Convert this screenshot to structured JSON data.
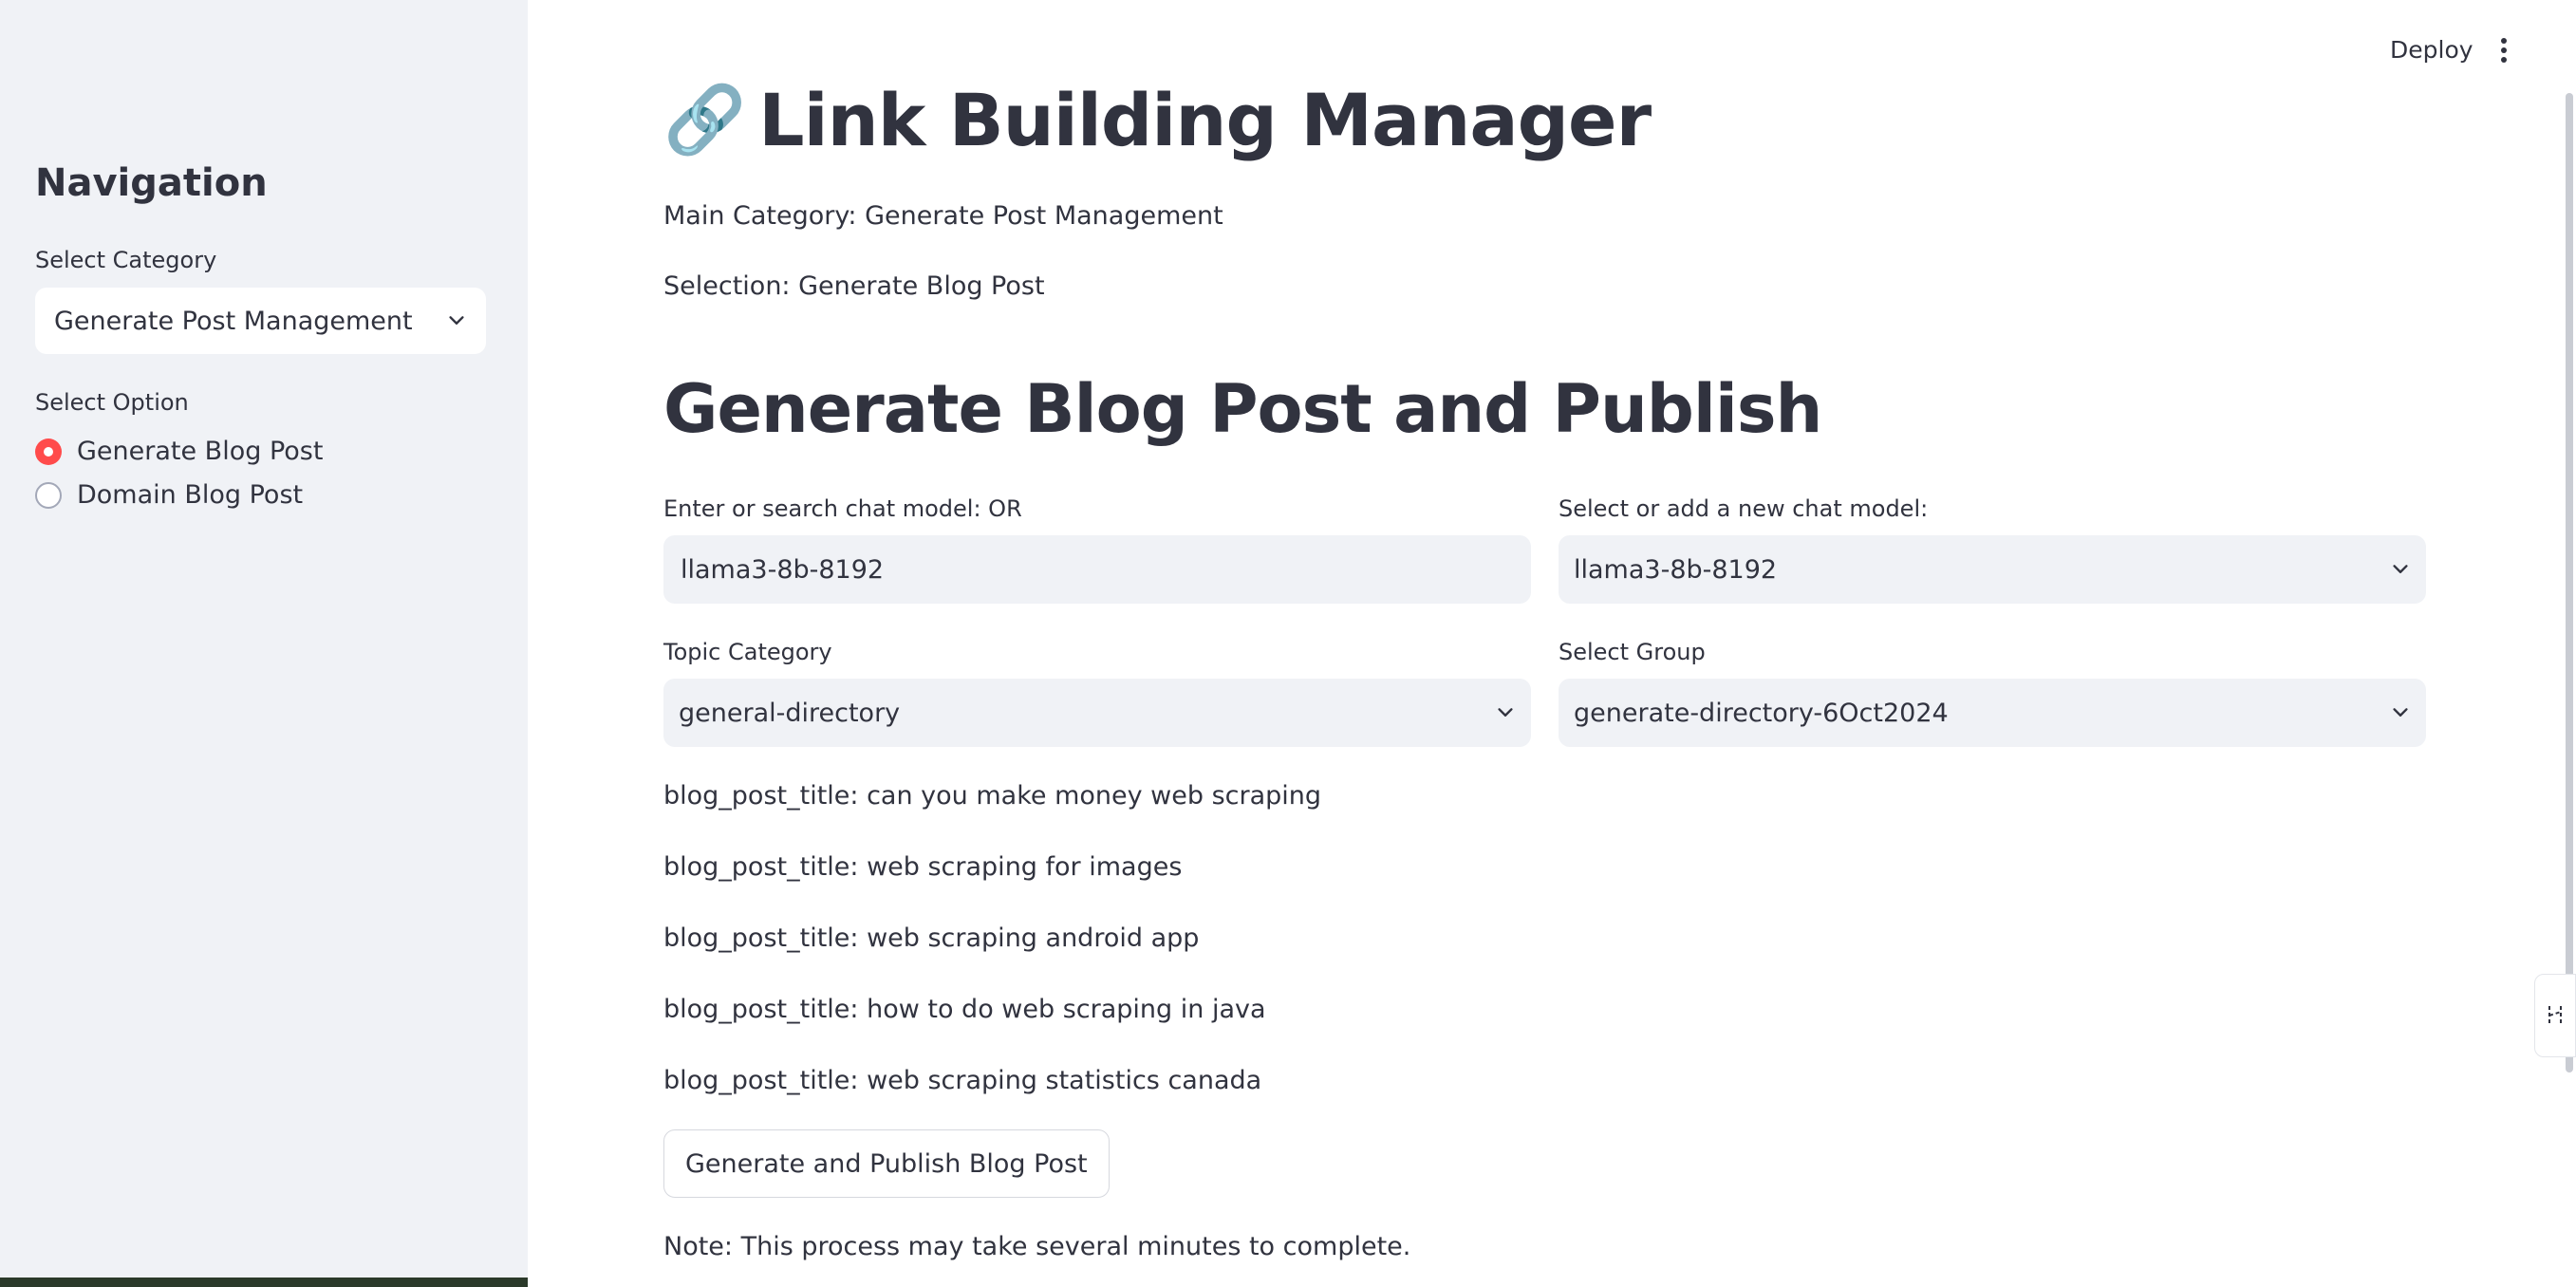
{
  "sidebar": {
    "title": "Navigation",
    "category_label": "Select Category",
    "category_value": "Generate Post Management",
    "option_label": "Select Option",
    "options": [
      {
        "label": "Generate Blog Post",
        "selected": true
      },
      {
        "label": "Domain Blog Post",
        "selected": false
      }
    ]
  },
  "header": {
    "deploy_label": "Deploy",
    "menu_icon": "more-vertical-icon"
  },
  "main": {
    "title_icon": "🔗",
    "title": "Link Building Manager",
    "main_category": "Main Category: Generate Post Management",
    "selection": "Selection: Generate Blog Post",
    "section_title": "Generate Blog Post and Publish",
    "chat_model_input_label": "Enter or search chat model: OR",
    "chat_model_input_value": "llama3-8b-8192",
    "chat_model_select_label": "Select or add a new chat model:",
    "chat_model_select_value": "llama3-8b-8192",
    "topic_category_label": "Topic Category",
    "topic_category_value": "general-directory",
    "group_label": "Select Group",
    "group_value": "generate-directory-6Oct2024",
    "blog_post_titles": [
      "blog_post_title: can you make money web scraping",
      "blog_post_title: web scraping for images",
      "blog_post_title: web scraping android app",
      "blog_post_title: how to do web scraping in java",
      "blog_post_title: web scraping statistics canada"
    ],
    "publish_button": "Generate and Publish Blog Post",
    "note": "Note: This process may take several minutes to complete."
  },
  "colors": {
    "accent": "#ff4b4b",
    "sidebar_bg": "#f0f2f6",
    "text": "#31333f"
  }
}
